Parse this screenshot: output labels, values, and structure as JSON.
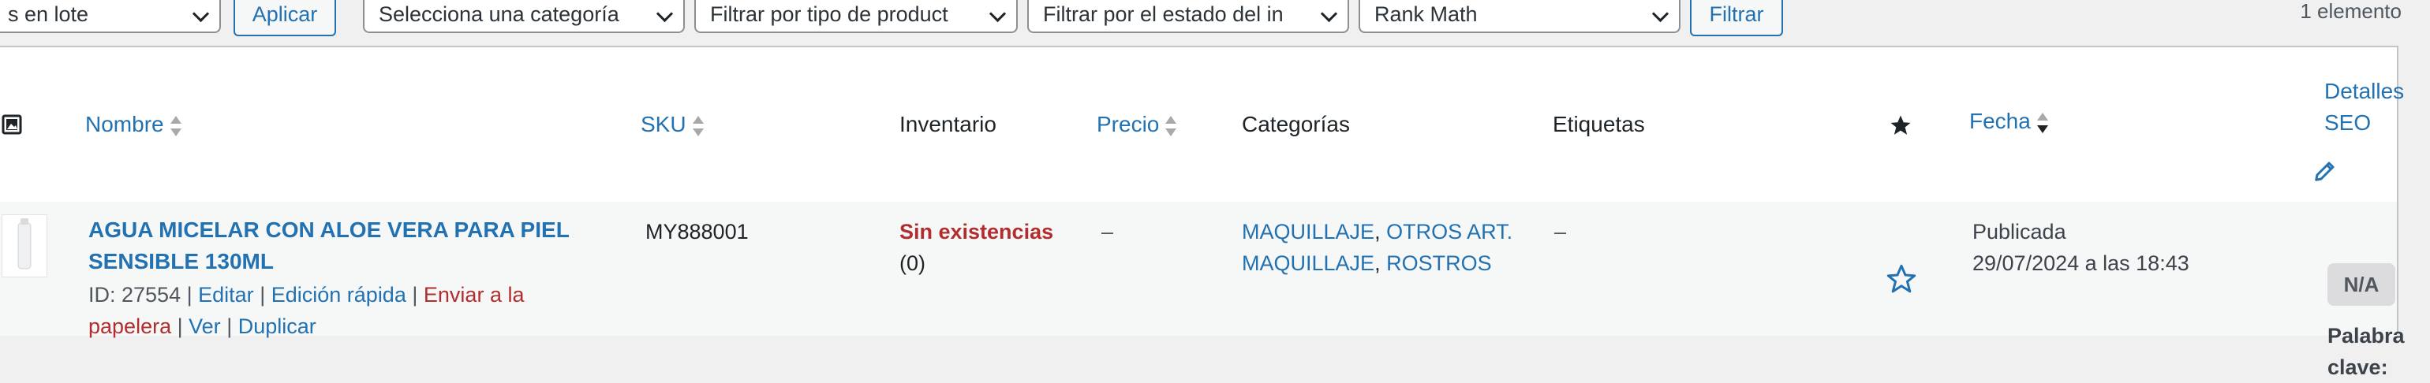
{
  "toolbar": {
    "bulk_action": "s en lote",
    "apply": "Aplicar",
    "category": "Selecciona una categoría",
    "product_type": "Filtrar por tipo de product",
    "stock_status": "Filtrar por el estado del in",
    "rank_math": "Rank Math",
    "filter": "Filtrar",
    "count": "1 elemento"
  },
  "columns": {
    "name": "Nombre",
    "sku": "SKU",
    "inventory": "Inventario",
    "price": "Precio",
    "categories": "Categorías",
    "tags": "Etiquetas",
    "date": "Fecha",
    "seo_line1": "Detalles",
    "seo_line2": "SEO"
  },
  "product": {
    "title_line1": "AGUA MICELAR CON ALOE VERA PARA PIEL",
    "title_line2": "SENSIBLE 130ML",
    "id_label": "ID: 27554",
    "sep": "|",
    "edit": "Editar",
    "quick_edit": "Edición rápida",
    "trash_line1": "Enviar a la",
    "trash_line2": "papelera",
    "view": "Ver",
    "duplicate": "Duplicar",
    "sku": "MY888001",
    "stock_status": "Sin existencias",
    "stock_qty": "(0)",
    "price": "–",
    "cat1": "MAQUILLAJE",
    "cat2": "OTROS ART. MAQUILLAJE",
    "cat2_line1": "OTROS ART.",
    "cat2_line2": "MAQUILLAJE",
    "cat3": "ROSTROS",
    "comma": ",",
    "tags": "–",
    "status": "Publicada",
    "date": "29/07/2024 a las 18:43",
    "seo_score": "N/A",
    "keyword_line1": "Palabra",
    "keyword_line2": "clave:"
  },
  "icons": {
    "thumb_header": "image-icon",
    "featured_header": "star-filled-icon",
    "featured_row": "star-outline-icon",
    "seo_edit": "pencil-icon"
  },
  "colors": {
    "link": "#2271b1",
    "out_of_stock": "#b32d2e",
    "trash": "#b32d2e"
  }
}
